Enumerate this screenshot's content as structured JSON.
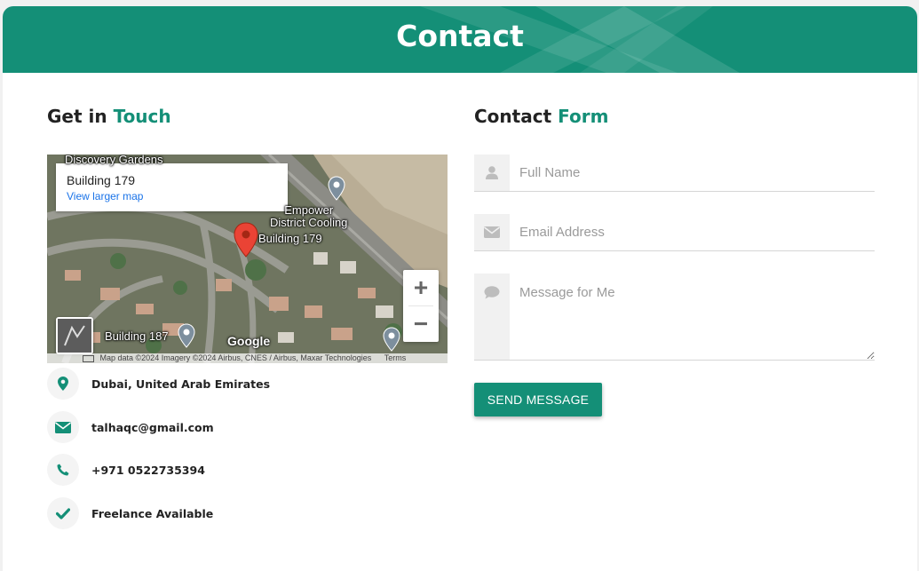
{
  "header": {
    "title": "Contact"
  },
  "left": {
    "title_prefix": "Get in",
    "title_accent": "Touch"
  },
  "map": {
    "info_place": "Building 179",
    "info_link": "View larger map",
    "labels": {
      "discovery": "Discovery Gardens",
      "empower": "Empower\nDistrict Cooling",
      "building179": "Building 179",
      "building187": "Building 187"
    },
    "google": "Google",
    "attribution": "Map data ©2024 Imagery ©2024 Airbus, CNES / Airbus, Maxar Technologies",
    "terms": "Terms",
    "zoom_in": "+",
    "zoom_out": "−"
  },
  "contact_info": [
    {
      "icon": "map-marker-icon",
      "text": "Dubai, United Arab Emirates"
    },
    {
      "icon": "envelope-icon",
      "text": "talhaqc@gmail.com"
    },
    {
      "icon": "phone-icon",
      "text": "+971 0522735394"
    },
    {
      "icon": "check-icon",
      "text": "Freelance Available"
    }
  ],
  "right": {
    "title_prefix": "Contact",
    "title_accent": "Form"
  },
  "form": {
    "name_placeholder": "Full Name",
    "email_placeholder": "Email Address",
    "message_placeholder": "Message for Me",
    "submit_label": "SEND MESSAGE"
  },
  "colors": {
    "accent": "#148f77",
    "text": "#222222",
    "placeholder": "#9a9a9a"
  }
}
